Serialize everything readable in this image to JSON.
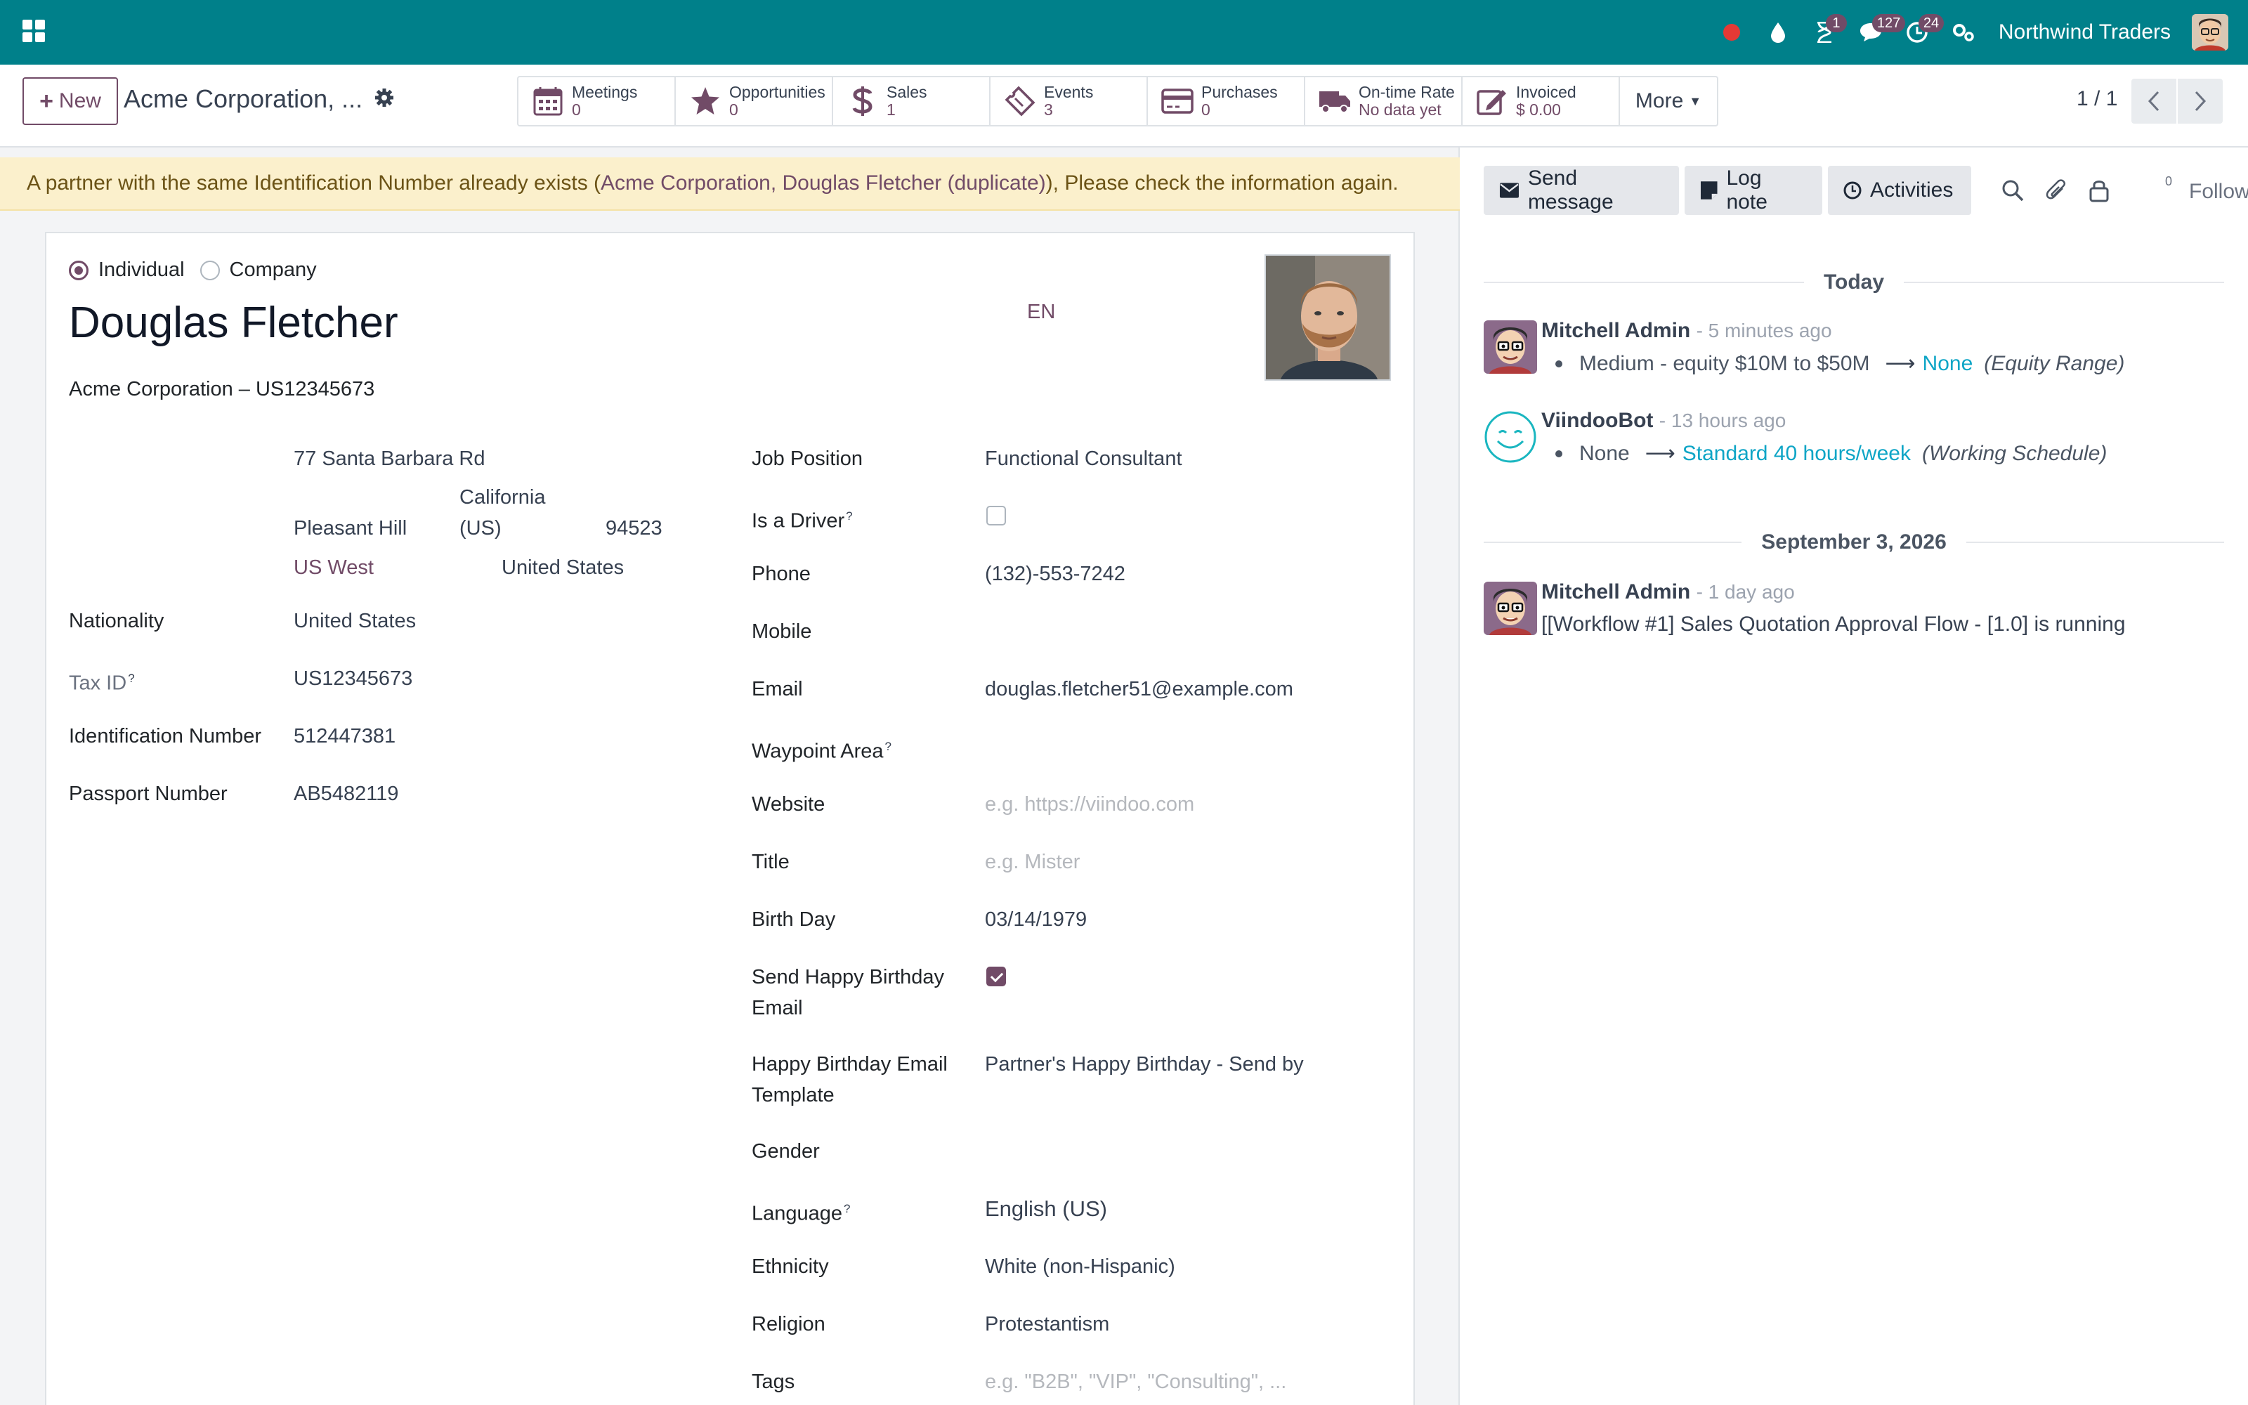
{
  "navbar": {
    "company": "Northwind Traders",
    "badges": {
      "activities_timer": "1",
      "messages": "127",
      "clock": "24"
    }
  },
  "control_panel": {
    "new_label": "New",
    "breadcrumb": "Acme Corporation, ...",
    "smart_buttons": [
      {
        "icon": "calendar-icon",
        "label": "Meetings",
        "value": "0"
      },
      {
        "icon": "star-icon",
        "label": "Opportunities",
        "value": "0"
      },
      {
        "icon": "dollar-icon",
        "label": "Sales",
        "value": "1"
      },
      {
        "icon": "ticket-icon",
        "label": "Events",
        "value": "3"
      },
      {
        "icon": "credit-card-icon",
        "label": "Purchases",
        "value": "0"
      },
      {
        "icon": "truck-icon",
        "label": "On-time Rate",
        "value": "No data yet"
      },
      {
        "icon": "invoice-edit-icon",
        "label": "Invoiced",
        "value": "$ 0.00"
      }
    ],
    "more_label": "More",
    "pager": "1 / 1"
  },
  "alert": {
    "prefix": "A partner with the same Identification Number already exists (",
    "link": "Acme Corporation, Douglas Fletcher (duplicate)",
    "suffix": "), Please check the information again."
  },
  "form": {
    "type_individual": "Individual",
    "type_company": "Company",
    "name": "Douglas Fletcher",
    "lang_code": "EN",
    "parent_line": "Acme Corporation – US12345673",
    "address": {
      "street": "77 Santa Barbara Rd",
      "city": "Pleasant Hill",
      "state_line1": "California",
      "state_line2": "(US)",
      "zip": "94523",
      "region": "US West",
      "country": "United States"
    },
    "left_fields": {
      "nationality_label": "Nationality",
      "nationality_value": "United States",
      "taxid_label": "Tax ID",
      "taxid_value": "US12345673",
      "idnum_label": "Identification Number",
      "idnum_value": "512447381",
      "passport_label": "Passport Number",
      "passport_value": "AB5482119"
    },
    "right_fields": {
      "job_label": "Job Position",
      "job_value": "Functional Consultant",
      "driver_label": "Is a Driver",
      "phone_label": "Phone",
      "phone_value": "(132)-553-7242",
      "mobile_label": "Mobile",
      "email_label": "Email",
      "email_value": "douglas.fletcher51@example.com",
      "waypoint_label": "Waypoint Area",
      "website_label": "Website",
      "website_placeholder": "e.g. https://viindoo.com",
      "title_label": "Title",
      "title_placeholder": "e.g. Mister",
      "birthday_label": "Birth Day",
      "birthday_value": "03/14/1979",
      "hbd_email_label_1": "Send Happy Birthday",
      "hbd_email_label_2": "Email",
      "hbd_tmpl_label_1": "Happy Birthday Email",
      "hbd_tmpl_label_2": "Template",
      "hbd_tmpl_value": "Partner's Happy Birthday - Send by",
      "gender_label": "Gender",
      "language_label": "Language",
      "language_value": "English (US)",
      "ethnicity_label": "Ethnicity",
      "ethnicity_value": "White (non-Hispanic)",
      "religion_label": "Religion",
      "religion_value": "Protestantism",
      "tags_label": "Tags",
      "tags_placeholder": "e.g. \"B2B\", \"VIP\", \"Consulting\", ..."
    },
    "checkbox_state": {
      "is_driver": false,
      "send_hbd_email": true
    }
  },
  "chatter": {
    "send_message": "Send message",
    "log_note": "Log note",
    "activities": "Activities",
    "follower_count": "0",
    "follow": "Follow",
    "date_today": "Today",
    "date_older": "September 3, 2026",
    "messages": [
      {
        "author": "Mitchell Admin",
        "time": "- 5 minutes ago",
        "old": "Medium - equity $10M to $50M",
        "new": "None",
        "field": "(Equity Range)"
      },
      {
        "author": "ViindooBot",
        "time": "- 13 hours ago",
        "old": "None",
        "new": "Standard 40 hours/week",
        "field": "(Working Schedule)"
      },
      {
        "author": "Mitchell Admin",
        "time": "- 1 day ago",
        "body": "[[Workflow #1] Sales Quotation Approval Flow - [1.0] is running"
      }
    ]
  }
}
